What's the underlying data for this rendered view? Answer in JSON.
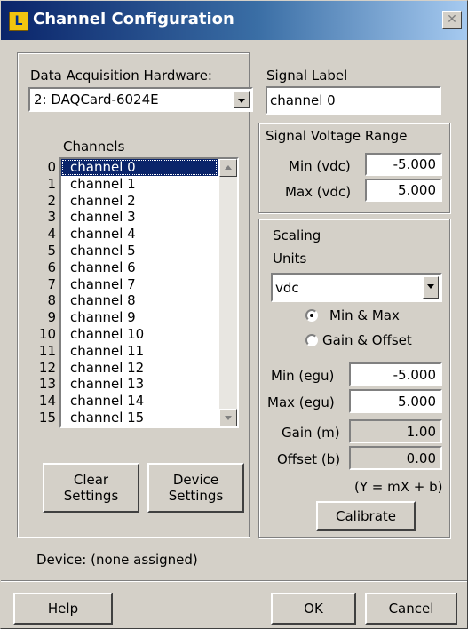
{
  "window": {
    "title": "Channel Configuration",
    "close_glyph": "✕"
  },
  "hardware": {
    "label": "Data Acquisition Hardware:",
    "selected": "2: DAQCard-6024E"
  },
  "channels": {
    "label": "Channels",
    "indices": [
      "0",
      "1",
      "2",
      "3",
      "4",
      "5",
      "6",
      "7",
      "8",
      "9",
      "10",
      "11",
      "12",
      "13",
      "14",
      "15"
    ],
    "items": [
      "channel 0",
      "channel 1",
      "channel 2",
      "channel 3",
      "channel 4",
      "channel 5",
      "channel 6",
      "channel 7",
      "channel 8",
      "channel 9",
      "channel 10",
      "channel 11",
      "channel 12",
      "channel 13",
      "channel 14",
      "channel 15"
    ],
    "selected_index": 0
  },
  "signal_label": {
    "label": "Signal Label",
    "value": "channel 0"
  },
  "voltage_range": {
    "title": "Signal Voltage Range",
    "min_label": "Min (vdc)",
    "min_value": "-5.000",
    "max_label": "Max (vdc)",
    "max_value": "5.000"
  },
  "scaling": {
    "title": "Scaling",
    "units_label": "Units",
    "units_value": "vdc",
    "radio_minmax": "Min & Max",
    "radio_gain": "Gain & Offset",
    "selected_mode": "Min & Max",
    "min_egu_label": "Min (egu)",
    "min_egu_value": "-5.000",
    "max_egu_label": "Max (egu)",
    "max_egu_value": "5.000",
    "gain_label": "Gain (m)",
    "gain_value": "1.00",
    "offset_label": "Offset (b)",
    "offset_value": "0.00",
    "formula": "(Y = mX + b)",
    "calibrate_label": "Calibrate"
  },
  "buttons": {
    "clear_line1": "Clear",
    "clear_line2": "Settings",
    "device_line1": "Device",
    "device_line2": "Settings"
  },
  "device_status": "Device: (none assigned)",
  "footer": {
    "help": "Help",
    "ok": "OK",
    "cancel": "Cancel"
  },
  "colors": {
    "face": "#d4d0c8",
    "title_start": "#0a246a",
    "title_end": "#a6caf0",
    "selection": "#0a246a"
  },
  "icons": {
    "app": "channel-config-app-icon",
    "close": "close-icon",
    "dropdown": "chevron-down-icon",
    "scroll_up": "scroll-up-icon",
    "scroll_down": "scroll-down-icon"
  }
}
